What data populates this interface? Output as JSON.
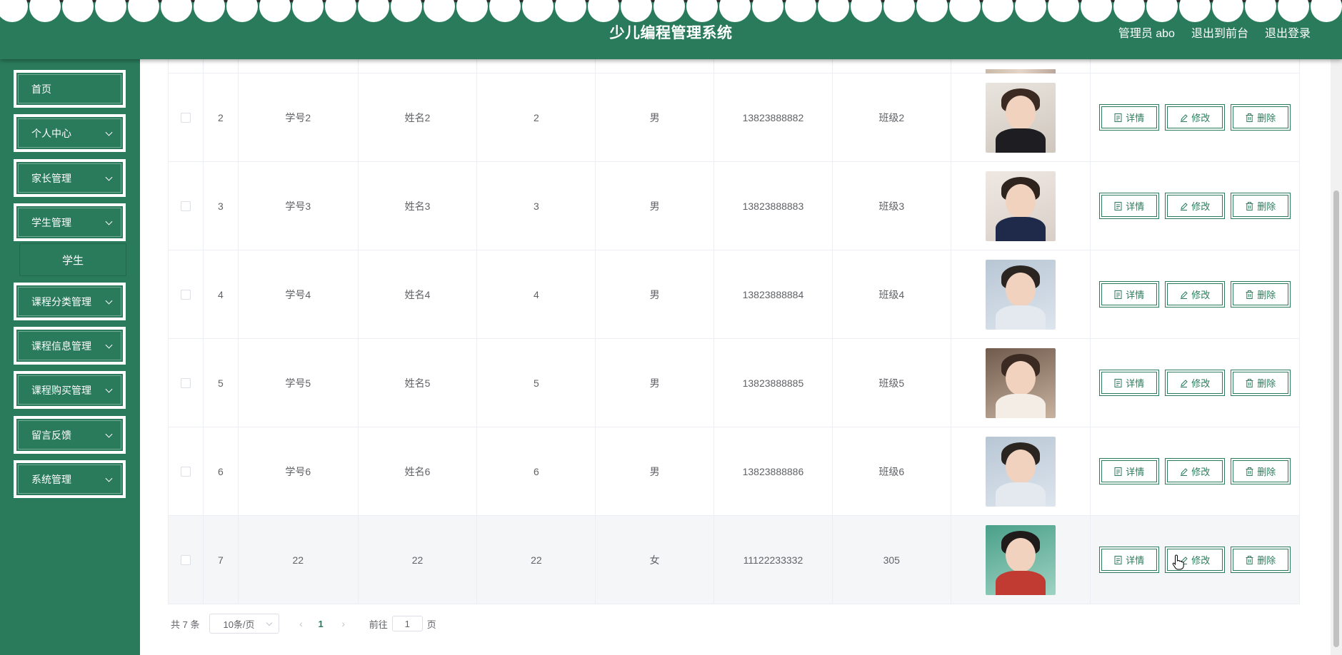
{
  "header": {
    "title": "少儿编程管理系统",
    "user": "管理员 abo",
    "to_front": "退出到前台",
    "logout": "退出登录"
  },
  "sidebar": {
    "items": [
      {
        "label": "首页",
        "has_arrow": false
      },
      {
        "label": "个人中心",
        "has_arrow": true
      },
      {
        "label": "家长管理",
        "has_arrow": true
      },
      {
        "label": "学生管理",
        "has_arrow": true
      },
      {
        "label": "课程分类管理",
        "has_arrow": true
      },
      {
        "label": "课程信息管理",
        "has_arrow": true
      },
      {
        "label": "课程购买管理",
        "has_arrow": true
      },
      {
        "label": "留言反馈",
        "has_arrow": true
      },
      {
        "label": "系统管理",
        "has_arrow": true
      }
    ],
    "sub_item": "学生"
  },
  "table": {
    "actions": {
      "detail": "详情",
      "edit": "修改",
      "delete": "删除"
    },
    "rows": [
      {
        "index": "2",
        "student_no": "学号2",
        "name": "姓名2",
        "age": "2",
        "gender": "男",
        "phone": "13823888882",
        "class": "班级2",
        "photo": "photo-girl-1"
      },
      {
        "index": "3",
        "student_no": "学号3",
        "name": "姓名3",
        "age": "3",
        "gender": "男",
        "phone": "13823888883",
        "class": "班级3",
        "photo": "photo-girl-2"
      },
      {
        "index": "4",
        "student_no": "学号4",
        "name": "姓名4",
        "age": "4",
        "gender": "男",
        "phone": "13823888884",
        "class": "班级4",
        "photo": "photo-girl-3"
      },
      {
        "index": "5",
        "student_no": "学号5",
        "name": "姓名5",
        "age": "5",
        "gender": "男",
        "phone": "13823888885",
        "class": "班级5",
        "photo": "photo-girl-4"
      },
      {
        "index": "6",
        "student_no": "学号6",
        "name": "姓名6",
        "age": "6",
        "gender": "男",
        "phone": "13823888886",
        "class": "班级6",
        "photo": "photo-girl-3"
      },
      {
        "index": "7",
        "student_no": "22",
        "name": "22",
        "age": "22",
        "gender": "女",
        "phone": "11122233332",
        "class": "305",
        "photo": "photo-girl-5"
      }
    ]
  },
  "pagination": {
    "total": "共 7 条",
    "page_size": "10条/页",
    "current_page": "1",
    "goto_label": "前往",
    "goto_value": "1",
    "page_suffix": "页"
  },
  "colors": {
    "primary": "#2a7b5c",
    "text": "#606266",
    "border": "#ebeef5"
  }
}
